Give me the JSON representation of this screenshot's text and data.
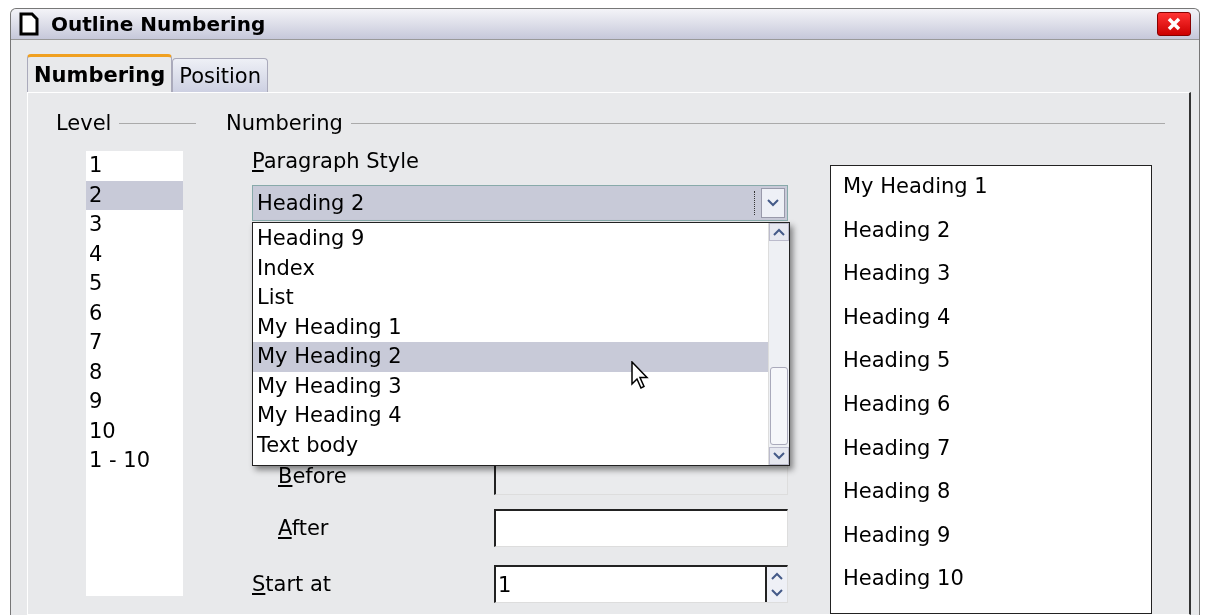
{
  "window": {
    "title": "Outline Numbering"
  },
  "tabs": [
    {
      "label": "Numbering",
      "selected": true
    },
    {
      "label": "Position",
      "selected": false
    }
  ],
  "level": {
    "heading": "Level",
    "items": [
      {
        "label": "1",
        "selected": false
      },
      {
        "label": "2",
        "selected": true
      },
      {
        "label": "3",
        "selected": false
      },
      {
        "label": "4",
        "selected": false
      },
      {
        "label": "5",
        "selected": false
      },
      {
        "label": "6",
        "selected": false
      },
      {
        "label": "7",
        "selected": false
      },
      {
        "label": "8",
        "selected": false
      },
      {
        "label": "9",
        "selected": false
      },
      {
        "label": "10",
        "selected": false
      },
      {
        "label": "1 - 10",
        "selected": false
      }
    ]
  },
  "numbering": {
    "heading": "Numbering",
    "paragraph_style": {
      "label": "Paragraph Style",
      "value": "Heading 2",
      "expanded": true,
      "options": [
        {
          "label": "Heading 9",
          "selected": false
        },
        {
          "label": "Index",
          "selected": false
        },
        {
          "label": "List",
          "selected": false
        },
        {
          "label": "My Heading 1",
          "selected": false
        },
        {
          "label": "My Heading 2",
          "selected": true
        },
        {
          "label": "My Heading 3",
          "selected": false
        },
        {
          "label": "My Heading 4",
          "selected": false
        },
        {
          "label": "Text body",
          "selected": false
        }
      ]
    },
    "before": {
      "label": "Before"
    },
    "after": {
      "label": "After"
    },
    "start_at": {
      "label": "Start at",
      "value": "1"
    }
  },
  "preview": [
    "My Heading 1",
    "Heading 2",
    "Heading 3",
    "Heading 4",
    "Heading 5",
    "Heading 6",
    "Heading 7",
    "Heading 8",
    "Heading 9",
    "Heading 10"
  ]
}
